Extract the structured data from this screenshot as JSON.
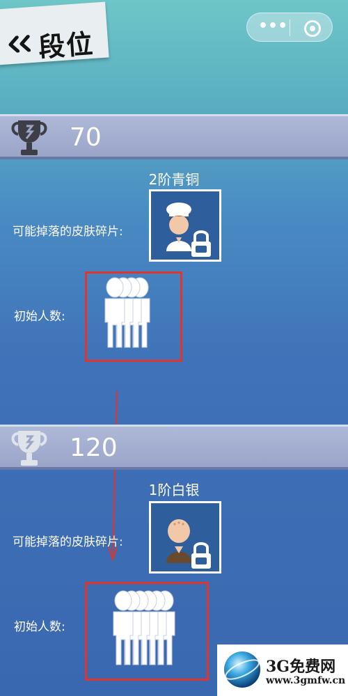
{
  "header": {
    "title": "段位",
    "back_icon": "double-chevron-left-icon",
    "menu_icon": "more-dots-icon",
    "close_icon": "target-circle-icon",
    "capsule_dots": "•••"
  },
  "ranks": [
    {
      "score": "70",
      "trophy": "bronze-trophy-icon",
      "title": "2阶青铜",
      "skin_label": "可能掉落的皮肤碎片:",
      "skin_icon": "chef-avatar-locked-icon",
      "people_label": "初始人数:",
      "people_count": 4
    },
    {
      "score": "120",
      "trophy": "silver-trophy-icon",
      "title": "1阶白银",
      "skin_label": "可能掉落的皮肤碎片:",
      "skin_icon": "monk-avatar-locked-icon",
      "people_label": "初始人数:",
      "people_count": 6
    }
  ],
  "annotation": {
    "highlight_color": "#e0342f"
  },
  "watermark": {
    "name": "3G免费网",
    "url": "www.3gmfw.cn"
  }
}
